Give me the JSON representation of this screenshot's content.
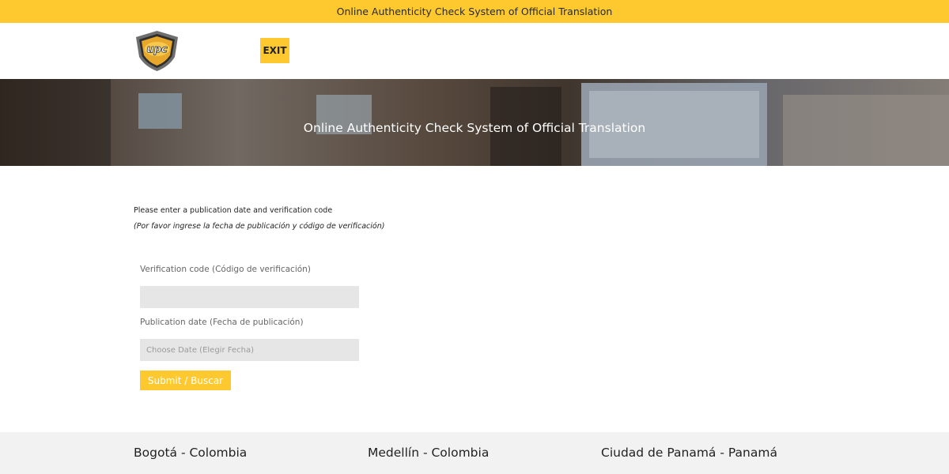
{
  "topbar": {
    "text": "Online Authenticity Check System of Official Translation"
  },
  "header": {
    "logo_text": "upc",
    "exit_label": "EXIT"
  },
  "hero": {
    "title": "Online Authenticity Check System of Official Translation"
  },
  "intro": {
    "line1": "Please enter a publication date and verification code",
    "line2": "(Por favor ingrese la fecha de publicación y código de verificación)"
  },
  "form": {
    "verification_label": "Verification code (Código de verificación)",
    "verification_value": "",
    "date_label": "Publication date (Fecha de publicación)",
    "date_placeholder": "Choose Date (Elegir Fecha)",
    "submit_label": "Submit / Buscar"
  },
  "footer": {
    "cities": [
      "Bogotá - Colombia",
      "Medellín - Colombia",
      "Ciudad de Panamá - Panamá"
    ]
  },
  "colors": {
    "accent": "#fec92f",
    "input_bg": "#e6e6e6",
    "footer_bg": "#f2f2f2"
  }
}
